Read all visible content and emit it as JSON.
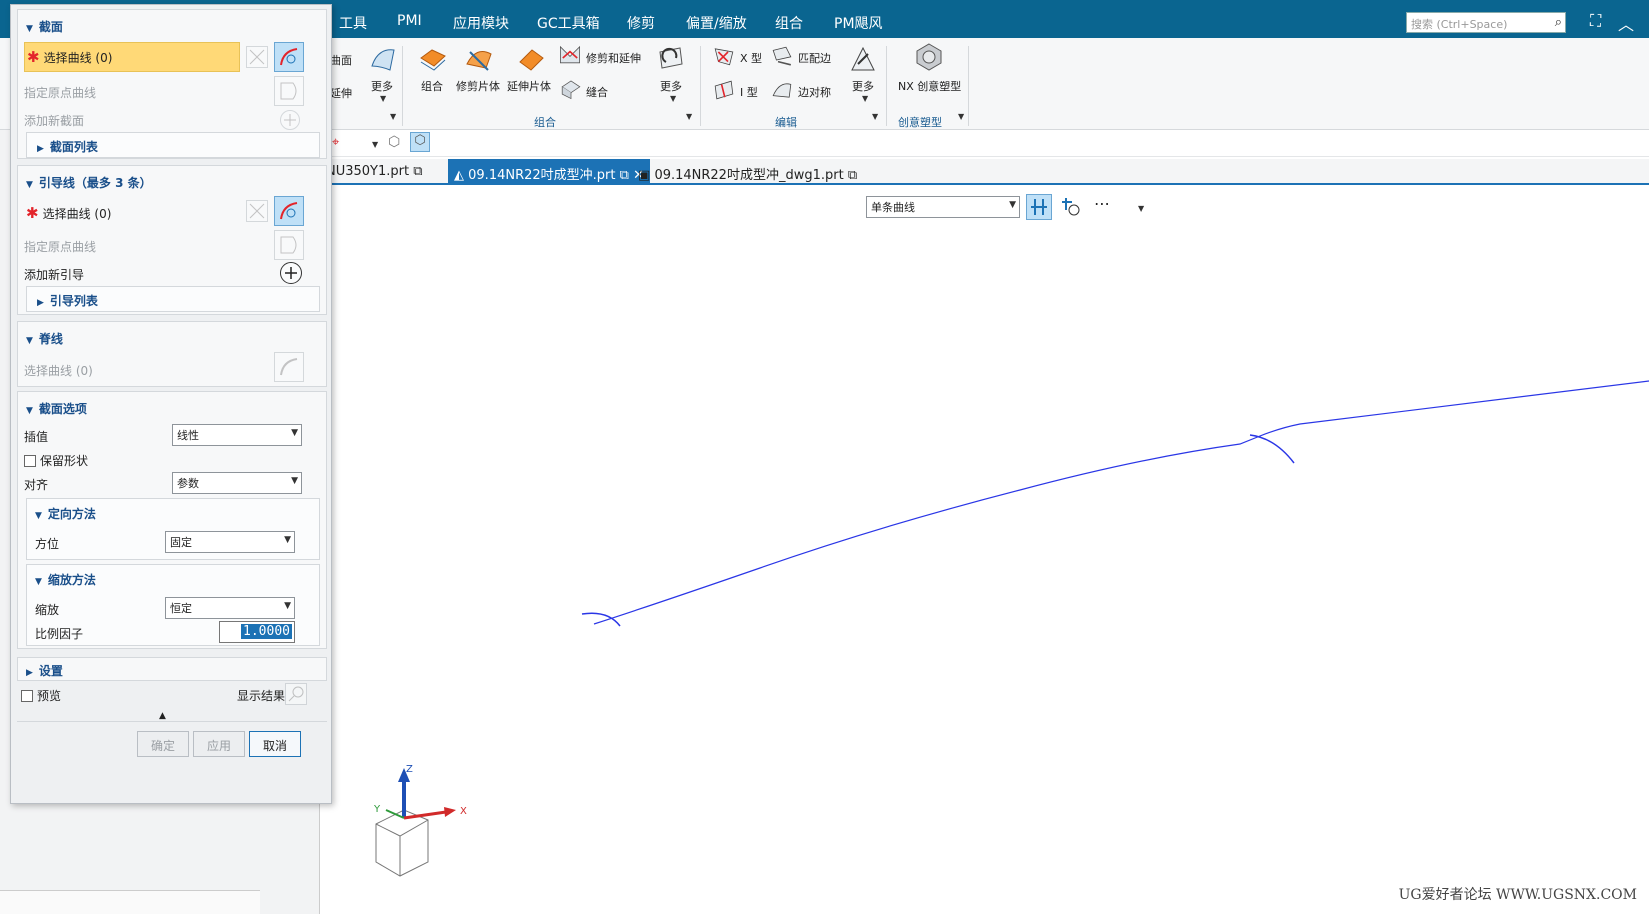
{
  "menubar": {
    "items": [
      "工具",
      "PMI",
      "应用模块",
      "GC工具箱",
      "修剪",
      "偏置/缩放",
      "组合",
      "PM飓风"
    ],
    "search_placeholder": "搜索 (Ctrl+Space)"
  },
  "ribbon": {
    "partial_labels": {
      "surface": "曲面",
      "extend": "延伸",
      "more1": "更多"
    },
    "combine": {
      "combine": "组合",
      "trim_sheet": "修剪片体",
      "extend_sheet": "延伸片体",
      "trim_extend": "修剪和延伸",
      "sew": "缝合",
      "more": "更多",
      "group": "组合"
    },
    "edit": {
      "x_type": "X 型",
      "i_type": "I 型",
      "match_edge": "匹配边",
      "edge_sym": "边对称",
      "more": "更多",
      "group": "编辑"
    },
    "creative": {
      "nx_realize": "NX 创意塑型",
      "group": "创意塑型"
    }
  },
  "tabs": [
    "NU350Y1.prt",
    "09.14NR22吋成型冲.prt",
    "09.14NR22吋成型冲_dwg1.prt"
  ],
  "selection_bar": {
    "curve_rule": "单条曲线"
  },
  "watermark": "UG爱好者论坛 WWW.UGSNX.COM",
  "dialog": {
    "section": {
      "title": "截面",
      "select_curve": "选择曲线 (0)",
      "specify_origin": "指定原点曲线",
      "add_new": "添加新截面",
      "list": "截面列表"
    },
    "guide": {
      "title": "引导线（最多 3 条）",
      "select_curve": "选择曲线 (0)",
      "specify_origin": "指定原点曲线",
      "add_new": "添加新引导",
      "list": "引导列表"
    },
    "spine": {
      "title": "脊线",
      "select_curve": "选择曲线 (0)"
    },
    "section_options": {
      "title": "截面选项",
      "interp_label": "插值",
      "interp_value": "线性",
      "keep_shape": "保留形状",
      "align_label": "对齐",
      "align_value": "参数",
      "orient_title": "定向方法",
      "orient_label": "方位",
      "orient_value": "固定",
      "scale_title": "缩放方法",
      "scale_label": "缩放",
      "scale_value": "恒定",
      "factor_label": "比例因子",
      "factor_value": "1.0000"
    },
    "settings": {
      "title": "设置"
    },
    "preview": {
      "label": "预览",
      "show_result": "显示结果"
    },
    "buttons": {
      "ok": "确定",
      "apply": "应用",
      "cancel": "取消"
    }
  },
  "csys": {
    "x": "X",
    "y": "Y",
    "z": "Z"
  },
  "colors": {
    "menubar": "#0a6590",
    "accent": "#1c72b5",
    "selection": "#ffd977",
    "curve": "#2a36e6"
  }
}
